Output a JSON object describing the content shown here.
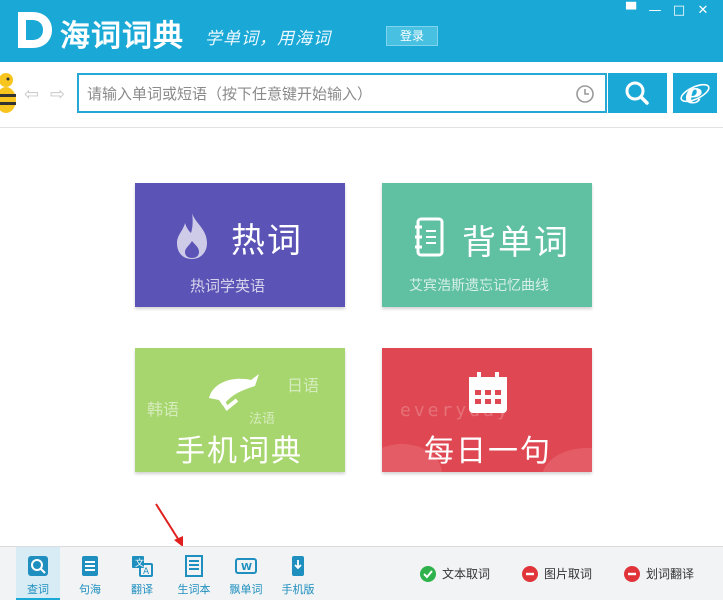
{
  "app": {
    "name": "海词词典",
    "slogan": "学单词，用海词",
    "login_label": "登录",
    "window_controls": [
      "▀",
      "—",
      "□",
      "✕"
    ]
  },
  "search": {
    "placeholder": "请输入单词或短语（按下任意键开始输入）",
    "value": ""
  },
  "tiles": {
    "hot": {
      "title": "热词",
      "subtitle": "热词学英语"
    },
    "vocab": {
      "title": "背单词",
      "subtitle": "艾宾浩斯遗忘记忆曲线"
    },
    "mobile": {
      "title": "手机词典",
      "deco_korean": "韩语",
      "deco_japanese": "日语",
      "deco_french": "法语"
    },
    "daily": {
      "title": "每日一句",
      "deco_text": "everyday"
    }
  },
  "bottom_nav": [
    {
      "label": "查词",
      "icon": "search-book-icon",
      "active": true
    },
    {
      "label": "句海",
      "icon": "sentence-list-icon",
      "active": false
    },
    {
      "label": "翻译",
      "icon": "translate-icon",
      "active": false
    },
    {
      "label": "生词本",
      "icon": "wordbook-icon",
      "active": false
    },
    {
      "label": "飘单词",
      "icon": "floating-word-icon",
      "active": false
    },
    {
      "label": "手机版",
      "icon": "mobile-icon",
      "active": false
    }
  ],
  "tools": [
    {
      "label": "文本取词",
      "state": "on",
      "color": "#2fb24c"
    },
    {
      "label": "图片取词",
      "state": "off",
      "color": "#e0343a"
    },
    {
      "label": "划词翻译",
      "state": "off",
      "color": "#e0343a"
    }
  ],
  "colors": {
    "brand": "#1aa8d6",
    "hot_tile": "#5b53b5",
    "vocab_tile": "#5fc0a2",
    "mobile_tile": "#a6d66d",
    "daily_tile": "#df4852"
  }
}
